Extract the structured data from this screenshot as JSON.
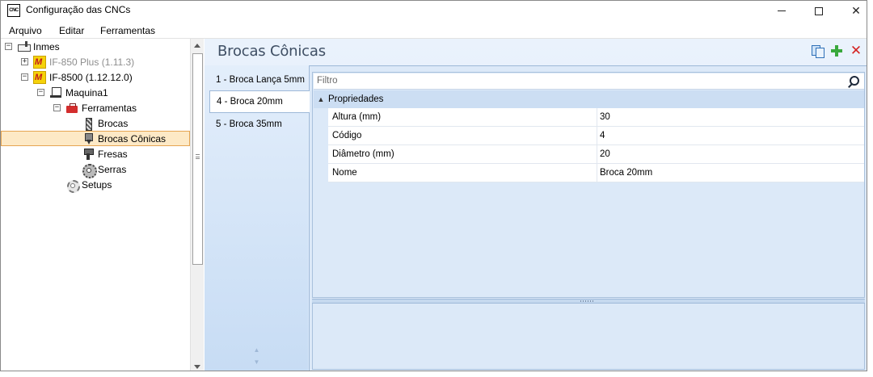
{
  "window": {
    "title": "Configuração das CNCs",
    "icon_label": "CNC"
  },
  "menu": {
    "items": [
      "Arquivo",
      "Editar",
      "Ferramentas"
    ]
  },
  "tree": {
    "root": "Inmes",
    "machine1": "IF-850 Plus (1.11.3)",
    "machine2": "IF-8500 (1.12.12.0)",
    "maquina": "Maquina1",
    "ferramentas": "Ferramentas",
    "brocas": "Brocas",
    "brocas_conicas": "Brocas Cônicas",
    "fresas": "Fresas",
    "serras": "Serras",
    "setups": "Setups"
  },
  "panel": {
    "title": "Brocas Cônicas"
  },
  "tabs": [
    "1 - Broca Lança 5mm",
    "4 - Broca 20mm",
    "5 - Broca 35mm"
  ],
  "filter": {
    "placeholder": "Filtro"
  },
  "properties": {
    "category": "Propriedades",
    "rows": [
      {
        "name": "Altura (mm)",
        "value": "30"
      },
      {
        "name": "Código",
        "value": "4"
      },
      {
        "name": "Diâmetro (mm)",
        "value": "20"
      },
      {
        "name": "Nome",
        "value": "Broca 20mm"
      }
    ]
  },
  "icons": {
    "copy": "copy-icon",
    "add": "add-icon",
    "delete": "delete-icon",
    "search": "search-icon"
  },
  "colors": {
    "selection_bg": "#fde9c6",
    "selection_border": "#e6a552",
    "panel_title": "#3f4f64",
    "panel_bg": "#dce9f8",
    "add_green": "#39a83c",
    "delete_red": "#d42424"
  }
}
